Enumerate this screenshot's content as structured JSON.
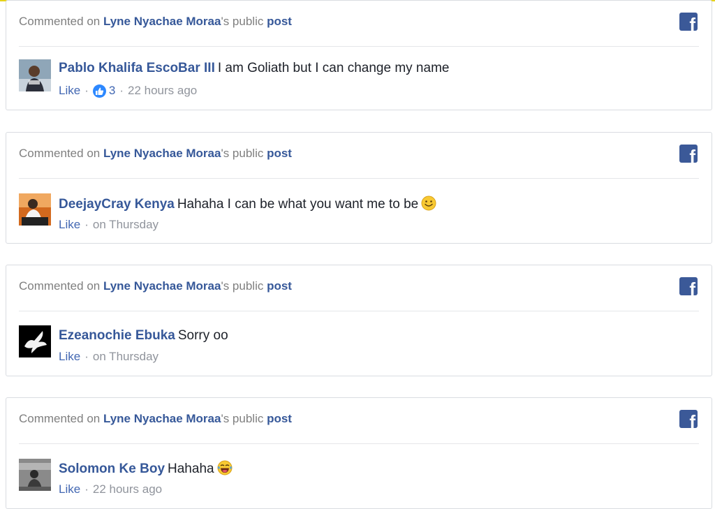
{
  "cards": [
    {
      "head_prefix": "Commented on ",
      "page_name": "Lyne Nyachae Moraa",
      "head_mid": "'s public ",
      "post_link": "post",
      "author": "Pablo Khalifa EscoBar III",
      "text": "I am Goliath but I can change my name",
      "like": "Like",
      "reaction_count": "3",
      "time": "22 hours ago"
    },
    {
      "head_prefix": "Commented on ",
      "page_name": "Lyne Nyachae Moraa",
      "head_mid": "'s public ",
      "post_link": "post",
      "author": "DeejayCray Kenya",
      "text": "Hahaha I can be what you want me to be",
      "emoji_icon": "smiley-face-icon",
      "like": "Like",
      "time": "on Thursday"
    },
    {
      "head_prefix": "Commented on ",
      "page_name": "Lyne Nyachae Moraa",
      "head_mid": "'s public ",
      "post_link": "post",
      "author": "Ezeanochie Ebuka",
      "text": "Sorry oo",
      "like": "Like",
      "time": "on Thursday"
    },
    {
      "head_prefix": "Commented on ",
      "page_name": "Lyne Nyachae Moraa",
      "head_mid": "'s public ",
      "post_link": "post",
      "author": "Solomon Ke Boy",
      "text": "Hahaha",
      "emoji_icon": "tears-of-joy-icon",
      "like": "Like",
      "time": "22 hours ago"
    }
  ],
  "colors": {
    "link": "#365899",
    "facebook_blue": "#3b5998",
    "muted": "#90949c",
    "top_bar": "#e6d21a"
  },
  "fb_glyph": "f"
}
